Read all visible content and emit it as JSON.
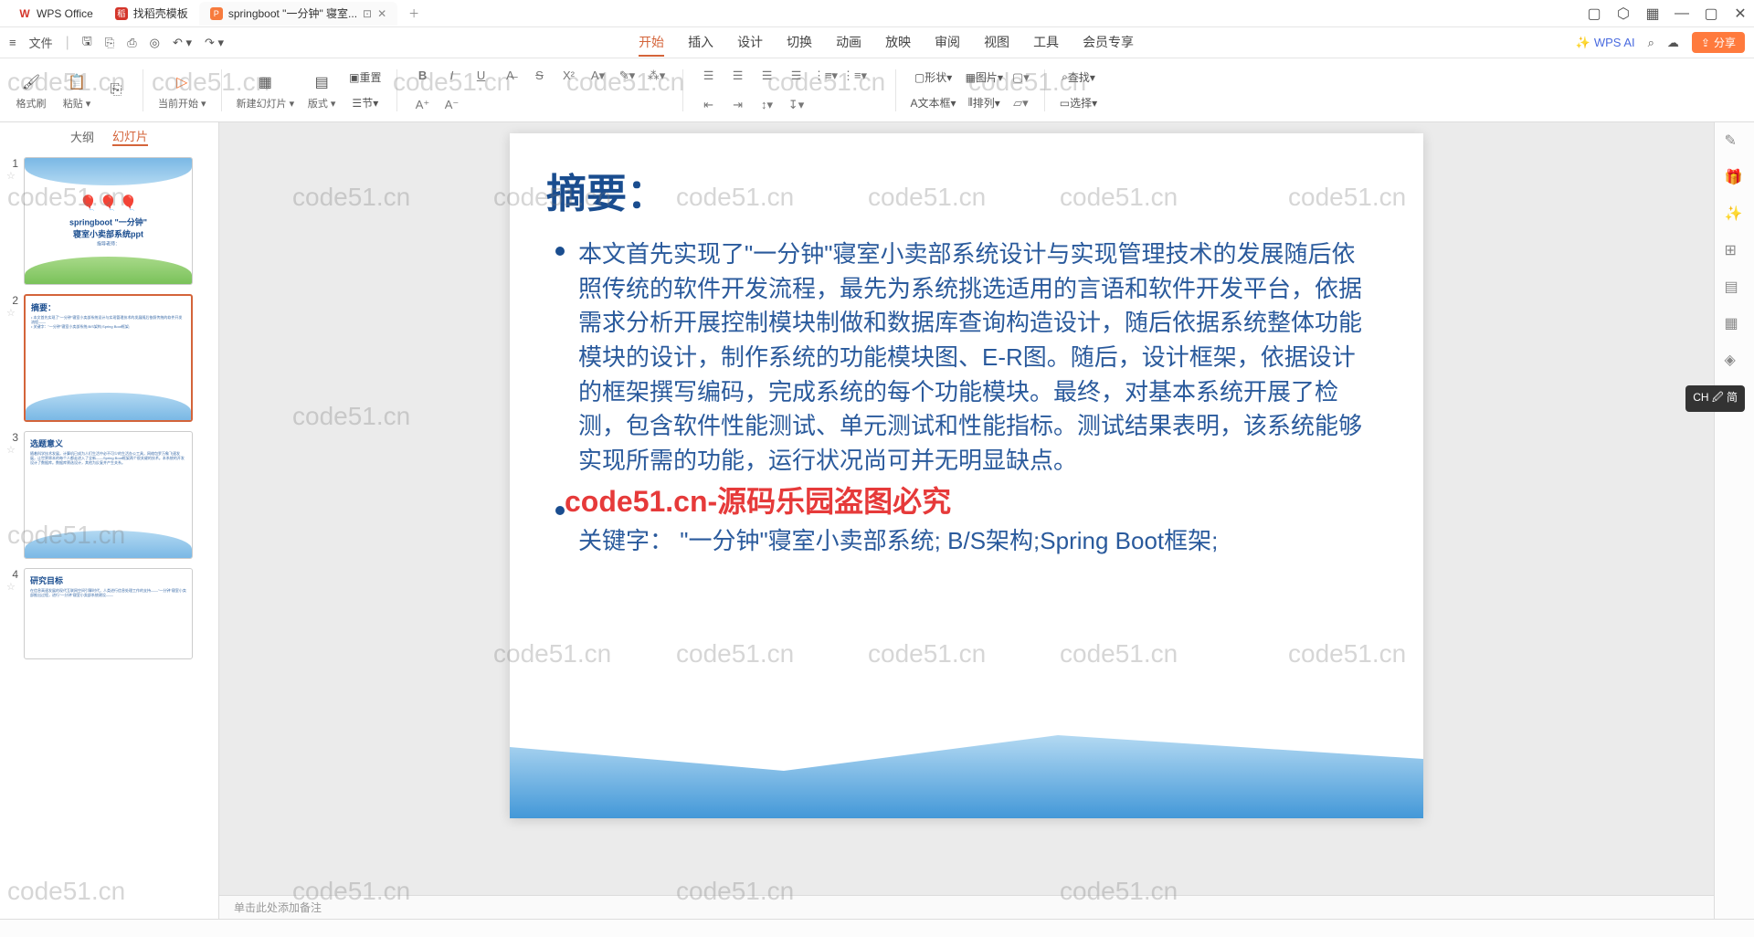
{
  "tabs": {
    "t0": {
      "icon": "W",
      "label": "WPS Office"
    },
    "t1": {
      "icon": "稻",
      "label": "找稻壳模板"
    },
    "t2": {
      "icon": "P",
      "label": "springboot \"一分钟\" 寝室..."
    }
  },
  "quickbar": {
    "file": "文件"
  },
  "menu": {
    "start": "开始",
    "insert": "插入",
    "design": "设计",
    "transition": "切换",
    "animation": "动画",
    "slideshow": "放映",
    "review": "审阅",
    "view": "视图",
    "tools": "工具",
    "vip": "会员专享"
  },
  "righttools": {
    "ai": "WPS AI",
    "share": "分享"
  },
  "ribbon": {
    "format": "格式刷",
    "paste": "粘贴",
    "current": "当前开始",
    "newslide": "新建幻灯片",
    "layout": "版式",
    "reset": "重置",
    "section": "节",
    "shape": "形状",
    "image": "图片",
    "textbox": "文本框",
    "arrange": "排列",
    "find": "查找",
    "select": "选择"
  },
  "panel": {
    "outline": "大纲",
    "slides": "幻灯片"
  },
  "thumbs": {
    "s1": "springboot \"一分钟\" 寝室小卖部系统ppt",
    "s1b": "指导老师：",
    "s2": "摘要：",
    "s3": "选题意义",
    "s4": "研究目标"
  },
  "slide": {
    "title": "摘要：",
    "p1": "本文首先实现了\"一分钟\"寝室小卖部系统设计与实现管理技术的发展随后依照传统的软件开发流程，最先为系统挑选适用的言语和软件开发平台，依据需求分析开展控制模块制做和数据库查询构造设计，随后依据系统整体功能模块的设计，制作系统的功能模块图、E-R图。随后，设计框架，依据设计的框架撰写编码，完成系统的每个功能模块。最终，对基本系统开展了检测，包含软件性能测试、单元测试和性能指标。测试结果表明，该系统能够实现所需的功能，运行状况尚可并无明显缺点。",
    "p2": "关键字：   \"一分钟\"寝室小卖部系统; B/S架构;Spring Boot框架;"
  },
  "notes_placeholder": "单击此处添加备注",
  "ime": "CH 🖉 简",
  "watermarks": {
    "w1": "code51.cn",
    "w2": "code51.cn",
    "w3": "code51.cn",
    "w4": "code51.cn",
    "w5": "code51.cn",
    "w6": "code51.cn",
    "w7": "code51.cn",
    "w8": "code51.cn",
    "w9": "code51.cn",
    "w10": "code51.cn",
    "w11": "code51.cn",
    "w12": "code51.cn",
    "w13": "code51.cn",
    "w14": "code51.cn",
    "w15": "code51.cn",
    "w16": "code51.cn",
    "w17": "code51.cn",
    "w18": "code51.cn",
    "w19": "code51.cn",
    "w20": "code51.cn",
    "w21": "code51.cn",
    "w22": "code51.cn",
    "w23": "code51.cn",
    "w24": "code51.cn",
    "red": "code51.cn-源码乐园盗图必究"
  }
}
